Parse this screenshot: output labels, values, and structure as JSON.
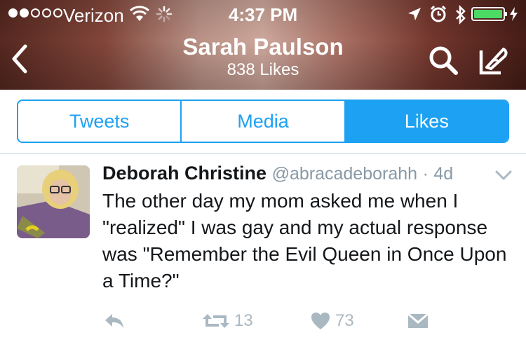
{
  "status_bar": {
    "carrier": "Verizon",
    "time": "4:37 PM"
  },
  "header": {
    "title": "Sarah Paulson",
    "subtitle": "838 Likes"
  },
  "tabs": [
    {
      "label": "Tweets",
      "active": false
    },
    {
      "label": "Media",
      "active": false
    },
    {
      "label": "Likes",
      "active": true
    }
  ],
  "tweet": {
    "author_name": "Deborah Christine",
    "author_handle": "@abracadeborahh",
    "separator": "·",
    "age": "4d",
    "text": "The other day my mom asked me when I \"realized\" I was gay and my actual response was \"Remember the Evil Queen in Once Upon a Time?\"",
    "retweets": "13",
    "likes": "73"
  },
  "colors": {
    "accent": "#1da1f2",
    "muted": "#aab8c2",
    "text": "#14171a"
  },
  "icons": [
    "signal-icon",
    "wifi-icon",
    "activity-spinner-icon",
    "location-icon",
    "alarm-icon",
    "bluetooth-icon",
    "battery-icon",
    "back-chevron-icon",
    "search-icon",
    "compose-icon",
    "chevron-down-icon",
    "reply-icon",
    "retweet-icon",
    "heart-icon",
    "direct-message-icon"
  ]
}
